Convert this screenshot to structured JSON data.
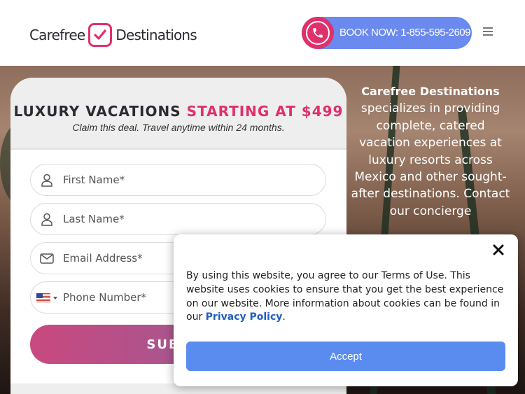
{
  "header": {
    "logo_left": "Carefree",
    "logo_right": "Destinations",
    "book_label": "BOOK NOW: 1-855-595-2609",
    "accent": "#e0306b",
    "button_color": "#6b8af0"
  },
  "form": {
    "title_main": "LUXURY VACATIONS ",
    "title_accent": "STARTING AT $499",
    "subtitle": "Claim this deal. Travel anytime within 24 months.",
    "first_name_placeholder": "First Name*",
    "last_name_placeholder": "Last Name*",
    "email_placeholder": "Email Address*",
    "phone_placeholder": "Phone Number*",
    "submit_label": "SUBMIT"
  },
  "intro": {
    "brand": "Carefree Destinations",
    "text": "specializes in providing complete, catered vacation experiences at luxury resorts across Mexico and other sought-after destinations. Contact our concierge"
  },
  "cookie": {
    "message": "By using this website, you agree to our Terms of Use. This website uses cookies to ensure that you get the best experience on our website. More information about cookies can be found in our ",
    "link_label": "Privacy Policy",
    "period": ".",
    "accept_label": "Accept"
  }
}
